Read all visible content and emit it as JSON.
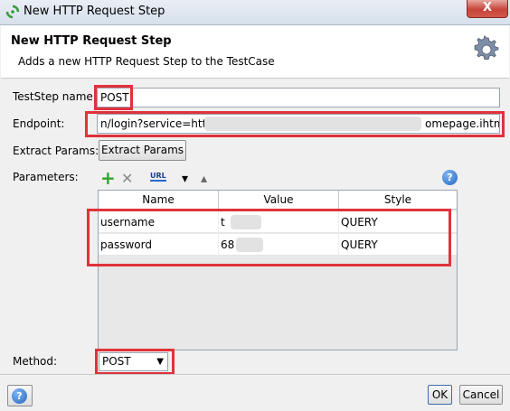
{
  "window": {
    "title": "New HTTP Request Step",
    "close_label": "X"
  },
  "header": {
    "title": "New HTTP Request Step",
    "description": "Adds a new HTTP Request Step to the TestCase"
  },
  "form": {
    "teststep_name_label": "TestStep name:",
    "teststep_name_value": "POST",
    "endpoint_label": "Endpoint:",
    "endpoint_value_start": "n/login?service=http",
    "endpoint_value_end": "omepage.ihtml",
    "extract_params_label": "Extract Params:",
    "extract_params_button": "Extract Params",
    "parameters_label": "Parameters:",
    "method_label": "Method:",
    "method_value": "POST"
  },
  "toolbar": {
    "add_icon": "+",
    "remove_icon": "✕",
    "url_icon_label": "URL",
    "move_down_icon": "▾",
    "move_up_icon": "▴",
    "help_icon": "?"
  },
  "table": {
    "columns": [
      "Name",
      "Value",
      "Style"
    ],
    "rows": [
      {
        "name": "username",
        "value": "t",
        "style": "QUERY"
      },
      {
        "name": "password",
        "value": "68",
        "style": "QUERY"
      }
    ]
  },
  "footer": {
    "help_icon": "?",
    "ok_label": "OK",
    "cancel_label": "Cancel"
  },
  "colors": {
    "highlight": "#e0323a",
    "accent": "#2467c2"
  }
}
